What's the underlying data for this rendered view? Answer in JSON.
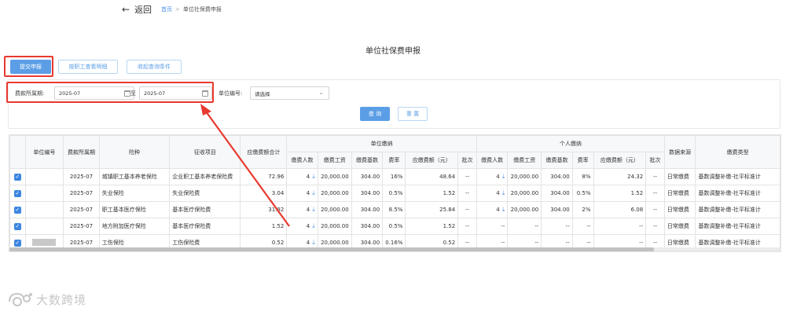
{
  "header": {
    "back_label": "返回",
    "breadcrumb_home": "首页",
    "breadcrumb_sep": ">",
    "breadcrumb_current": "单位社保费申报"
  },
  "page_title": "单位社保费申报",
  "toolbar": {
    "submit_label": "提交申报",
    "by_employee_label": "按职工查看明细",
    "collapse_label": "收起查询条件"
  },
  "filters": {
    "period_label": "费款所属期:",
    "period_start": "2025-07",
    "period_sep": "至",
    "period_end": "2025-07",
    "unit_no_label": "单位编号:",
    "unit_no_placeholder": "请选择",
    "query_label": "查 询",
    "reset_label": "重 置"
  },
  "table": {
    "group_unit": "单位缴纳",
    "group_personal": "个人缴纳",
    "headers": {
      "unit_no": "单位编号",
      "period": "费款所属期",
      "insurance": "险种",
      "item": "征收项目",
      "total": "应缴费额合计",
      "u_people": "缴费人数",
      "u_wage": "缴费工资",
      "u_base": "缴费基数",
      "u_rate": "费率",
      "u_amount": "应缴费额（元）",
      "u_batch": "批次",
      "p_people": "缴费人数",
      "p_wage": "缴费工资",
      "p_base": "缴费基数",
      "p_rate": "费率",
      "p_amount": "应缴费额（元）",
      "p_batch": "批次",
      "source": "数据来源",
      "type": "缴费类型"
    },
    "rows": [
      {
        "checked": true,
        "unit_no": "",
        "period": "2025-07",
        "insurance": "城镇职工基本养老保险",
        "item": "企业职工基本养老保险费",
        "total": "72.96",
        "u_people": "4",
        "u_wage": "20,000.00",
        "u_base": "304.00",
        "u_rate": "16%",
        "u_amount": "48.64",
        "u_batch": "--",
        "p_people": "4",
        "p_wage": "20,000.00",
        "p_base": "304.00",
        "p_rate": "8%",
        "p_amount": "24.32",
        "p_batch": "--",
        "source": "日常缴费",
        "type": "基数调整补缴-社平标准计"
      },
      {
        "checked": true,
        "unit_no": "",
        "period": "2025-07",
        "insurance": "失业保险",
        "item": "失业保险费",
        "total": "3.04",
        "u_people": "4",
        "u_wage": "20,000.00",
        "u_base": "304.00",
        "u_rate": "0.5%",
        "u_amount": "1.52",
        "u_batch": "--",
        "p_people": "4",
        "p_wage": "20,000.00",
        "p_base": "304.00",
        "p_rate": "0.5%",
        "p_amount": "1.52",
        "p_batch": "--",
        "source": "日常缴费",
        "type": "基数调整补缴-社平标准计"
      },
      {
        "checked": true,
        "unit_no": "",
        "period": "2025-07",
        "insurance": "职工基本医疗保险",
        "item": "基本医疗保险费",
        "total": "31.92",
        "u_people": "4",
        "u_wage": "20,000.00",
        "u_base": "304.00",
        "u_rate": "8.5%",
        "u_amount": "25.84",
        "u_batch": "--",
        "p_people": "4",
        "p_wage": "20,000.00",
        "p_base": "304.00",
        "p_rate": "2%",
        "p_amount": "6.08",
        "p_batch": "--",
        "source": "日常缴费",
        "type": "基数调整补缴-社平标准计"
      },
      {
        "checked": true,
        "unit_no": "",
        "period": "2025-07",
        "insurance": "地方附加医疗保险",
        "item": "基本医疗保险费",
        "total": "1.52",
        "u_people": "4",
        "u_wage": "20,000.00",
        "u_base": "304.00",
        "u_rate": "0.5%",
        "u_amount": "1.52",
        "u_batch": "--",
        "p_people": "--",
        "p_wage": "--",
        "p_base": "--",
        "p_rate": "--",
        "p_amount": "--",
        "p_batch": "--",
        "source": "日常缴费",
        "type": "基数调整补缴-社平标准计"
      },
      {
        "checked": true,
        "unit_no": "",
        "period": "2025-07",
        "insurance": "工伤保险",
        "item": "工伤保险费",
        "total": "0.52",
        "u_people": "4",
        "u_wage": "20,000.00",
        "u_base": "304.00",
        "u_rate": "0.16%",
        "u_amount": "0.52",
        "u_batch": "--",
        "p_people": "--",
        "p_wage": "--",
        "p_base": "--",
        "p_rate": "--",
        "p_amount": "--",
        "p_batch": "--",
        "source": "日常缴费",
        "type": "基数调整补缴-社平标准计"
      }
    ]
  },
  "watermark": "大数跨境",
  "colors": {
    "primary": "#5b9ee6",
    "highlight": "#e8392e",
    "checkbox": "#3d86e0"
  }
}
